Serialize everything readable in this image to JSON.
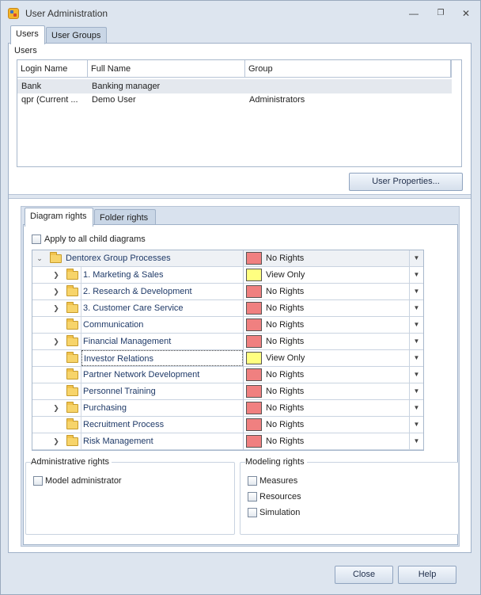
{
  "window": {
    "title": "User Administration"
  },
  "tabs": [
    {
      "label": "Users",
      "active": true
    },
    {
      "label": "User Groups",
      "active": false
    }
  ],
  "users_section": {
    "label": "Users",
    "columns": [
      "Login Name",
      "Full Name",
      "Group"
    ],
    "rows": [
      {
        "login": "Bank",
        "full_name": "Banking manager",
        "group": "",
        "selected": true
      },
      {
        "login": "qpr (Current ...",
        "full_name": "Demo User",
        "group": "Administrators",
        "selected": false
      }
    ],
    "properties_button": "User Properties..."
  },
  "rights_tabs": [
    {
      "label": "Diagram rights",
      "active": true
    },
    {
      "label": "Folder rights",
      "active": false
    }
  ],
  "apply_all_label": "Apply to all child diagrams",
  "tree": [
    {
      "name": "Dentorex Group Processes",
      "rights": "No Rights",
      "color": "#f08080",
      "level": 0,
      "expander": "down"
    },
    {
      "name": "1. Marketing & Sales",
      "rights": "View Only",
      "color": "#ffff80",
      "level": 1,
      "expander": "right"
    },
    {
      "name": "2. Research & Development",
      "rights": "No Rights",
      "color": "#f08080",
      "level": 1,
      "expander": "right"
    },
    {
      "name": "3. Customer Care Service",
      "rights": "No Rights",
      "color": "#f08080",
      "level": 1,
      "expander": "right"
    },
    {
      "name": "Communication",
      "rights": "No Rights",
      "color": "#f08080",
      "level": 1,
      "expander": ""
    },
    {
      "name": "Financial Management",
      "rights": "No Rights",
      "color": "#f08080",
      "level": 1,
      "expander": "right"
    },
    {
      "name": "Investor Relations",
      "rights": "View Only",
      "color": "#ffff80",
      "level": 1,
      "expander": "",
      "selected": true
    },
    {
      "name": "Partner Network Development",
      "rights": "No Rights",
      "color": "#f08080",
      "level": 1,
      "expander": ""
    },
    {
      "name": "Personnel Training",
      "rights": "No Rights",
      "color": "#f08080",
      "level": 1,
      "expander": ""
    },
    {
      "name": "Purchasing",
      "rights": "No Rights",
      "color": "#f08080",
      "level": 1,
      "expander": "right"
    },
    {
      "name": "Recruitment Process",
      "rights": "No Rights",
      "color": "#f08080",
      "level": 1,
      "expander": ""
    },
    {
      "name": "Risk Management",
      "rights": "No Rights",
      "color": "#f08080",
      "level": 1,
      "expander": "right"
    }
  ],
  "admin_rights": {
    "title": "Administrative rights",
    "items": [
      "Model administrator"
    ]
  },
  "modeling_rights": {
    "title": "Modeling rights",
    "items": [
      "Measures",
      "Resources",
      "Simulation"
    ]
  },
  "footer": {
    "close": "Close",
    "help": "Help"
  }
}
